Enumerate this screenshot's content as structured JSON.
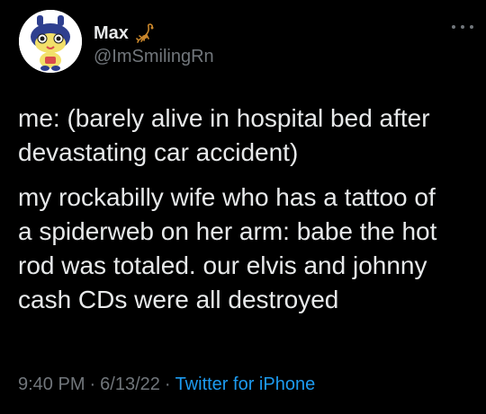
{
  "user": {
    "display_name": "Max",
    "handle": "@ImSmilingRn",
    "name_emoji_icon": "scorpion-icon",
    "avatar_icon": "tamagotchi-avatar"
  },
  "tweet": {
    "paragraphs": [
      "me: (barely alive in hospital bed after\ndevastating car accident)",
      "my rockabilly wife who has a tattoo of\na spiderweb on her arm: babe the hot\nrod was totaled. our elvis and johnny\ncash CDs were all destroyed"
    ]
  },
  "meta": {
    "time": "9:40 PM",
    "date": "6/13/22",
    "separator": "·",
    "source": "Twitter for iPhone"
  },
  "colors": {
    "background": "#000000",
    "text": "#e7e9ea",
    "secondary": "#71767b",
    "link": "#1d9bf0"
  }
}
